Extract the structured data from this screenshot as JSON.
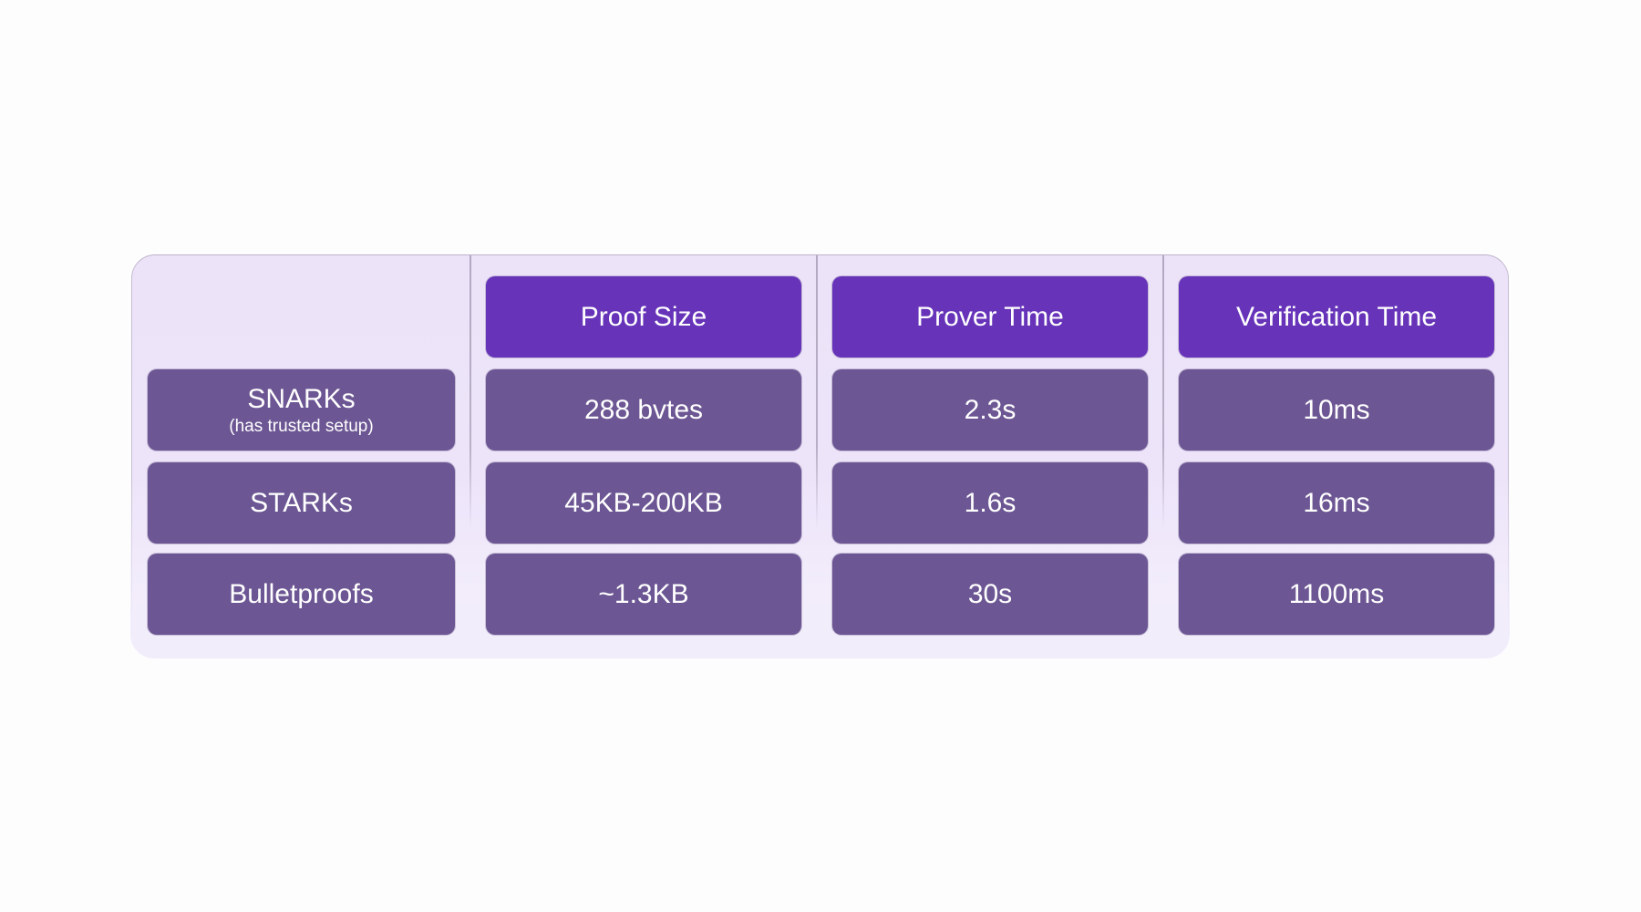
{
  "table": {
    "columns": [
      "Proof Size",
      "Prover Time",
      "Verification Time"
    ],
    "rows": [
      {
        "name": "SNARKs",
        "note": "(has trusted setup)",
        "values": [
          "288 bvtes",
          "2.3s",
          "10ms"
        ]
      },
      {
        "name": "STARKs",
        "note": "",
        "values": [
          "45KB-200KB",
          "1.6s",
          "16ms"
        ]
      },
      {
        "name": "Bulletproofs",
        "note": "",
        "values": [
          "~1.3KB",
          "30s",
          "1100ms"
        ]
      }
    ]
  },
  "colors": {
    "header": "#6633b9",
    "cell": "#6c5693",
    "panel": "#ede4f9",
    "text": "#ffffff"
  }
}
